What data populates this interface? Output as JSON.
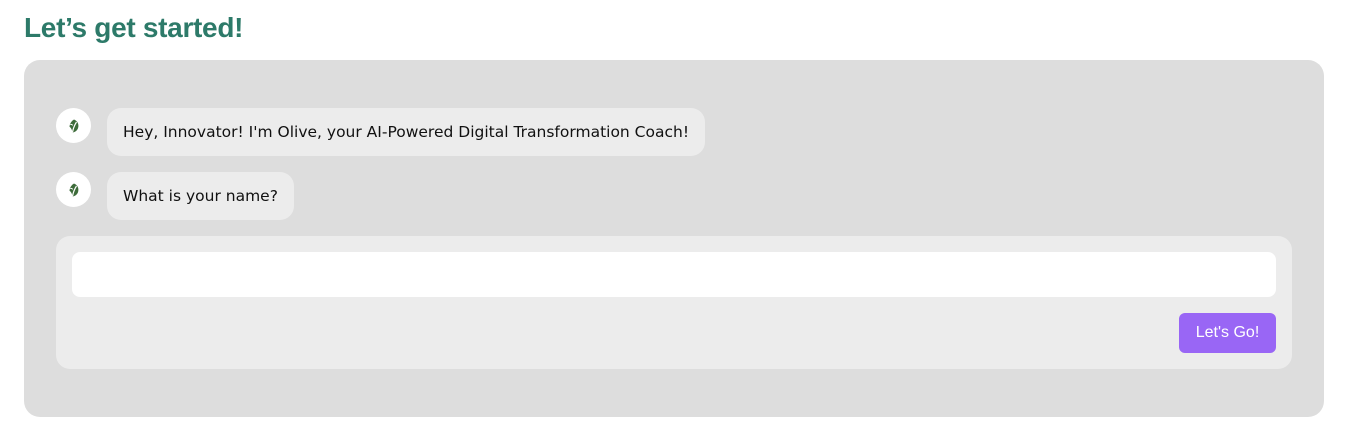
{
  "page": {
    "title": "Let’s get started!"
  },
  "chat": {
    "messages": [
      {
        "sender_icon": "olive-leaf-icon",
        "text": "Hey, Innovator! I'm Olive, your AI-Powered Digital Transformation Coach!"
      },
      {
        "sender_icon": "olive-leaf-icon",
        "text": "What is your name?"
      }
    ]
  },
  "input": {
    "value": "",
    "placeholder": ""
  },
  "actions": {
    "submit_label": "Let's Go!"
  },
  "colors": {
    "title": "#2d7a69",
    "panel_background": "#dddddd",
    "bubble_background": "#ececec",
    "button_accent": "#9966f5",
    "avatar_leaf": "#3d6b3a"
  }
}
